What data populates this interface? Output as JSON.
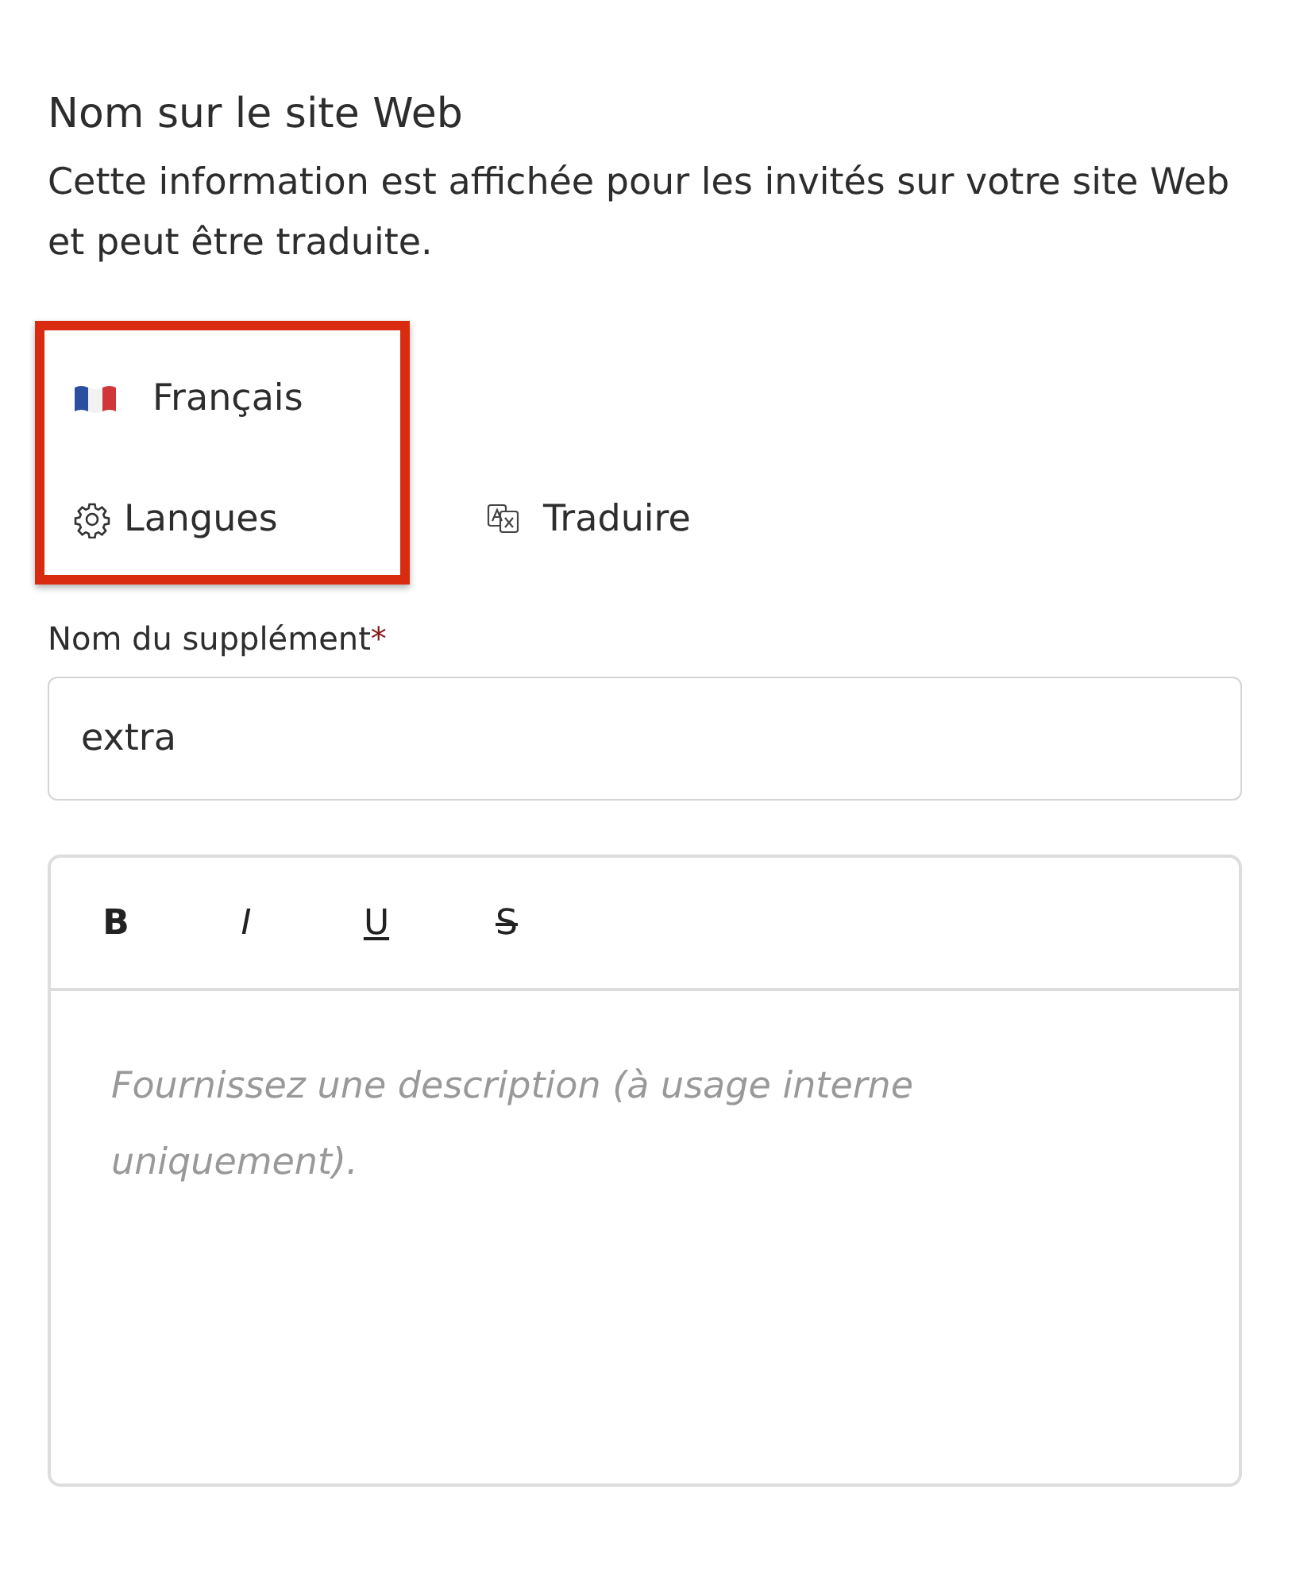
{
  "section": {
    "title": "Nom sur le site Web",
    "description": "Cette information est affichée pour les invités sur votre site Web et peut être traduite."
  },
  "language": {
    "current": "Français",
    "settings_label": "Langues",
    "translate_label": "Traduire"
  },
  "name_field": {
    "label": "Nom du supplément",
    "required_mark": "*",
    "value": "extra"
  },
  "editor": {
    "toolbar": [
      {
        "kind": "bold",
        "label": "B"
      },
      {
        "kind": "italic",
        "label": "I"
      },
      {
        "kind": "underline",
        "label": "U"
      },
      {
        "kind": "strike",
        "label": "S"
      }
    ],
    "placeholder": "Fournissez une description (à usage interne uniquement)."
  }
}
